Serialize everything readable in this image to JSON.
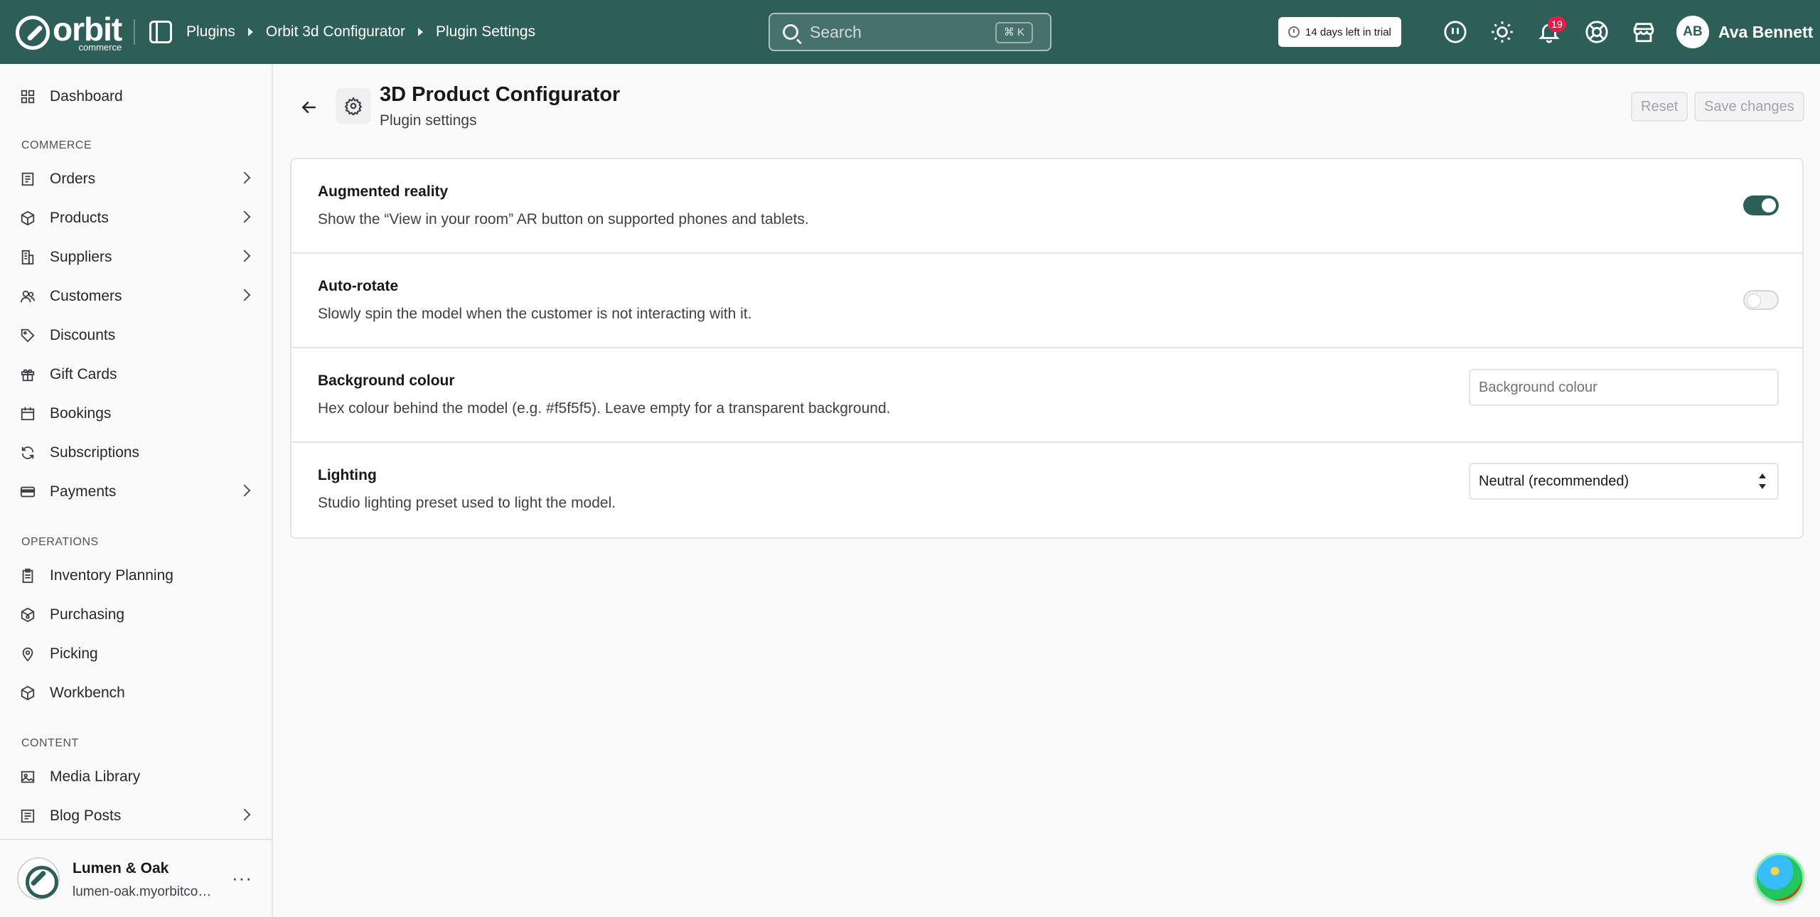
{
  "topbar": {
    "logo_text": "orbit",
    "logo_sub": "commerce",
    "breadcrumbs": [
      "Plugins",
      "Orbit 3d Configurator",
      "Plugin Settings"
    ],
    "search_placeholder": "Search",
    "search_shortcut": "⌘ K",
    "trial_text": "14 days left in trial",
    "notification_count": "19",
    "user_initials": "AB",
    "user_name": "Ava Bennett",
    "brand_color": "#2e5e58"
  },
  "sidebar": {
    "dashboard": "Dashboard",
    "sections": {
      "commerce": "COMMERCE",
      "operations": "OPERATIONS",
      "content": "CONTENT"
    },
    "commerce_items": [
      {
        "label": "Orders",
        "icon": "orders-icon",
        "expandable": true
      },
      {
        "label": "Products",
        "icon": "box-icon",
        "expandable": true
      },
      {
        "label": "Suppliers",
        "icon": "building-icon",
        "expandable": true
      },
      {
        "label": "Customers",
        "icon": "users-icon",
        "expandable": true
      },
      {
        "label": "Discounts",
        "icon": "tag-icon",
        "expandable": false
      },
      {
        "label": "Gift Cards",
        "icon": "gift-icon",
        "expandable": false
      },
      {
        "label": "Bookings",
        "icon": "calendar-icon",
        "expandable": false
      },
      {
        "label": "Subscriptions",
        "icon": "refresh-icon",
        "expandable": false
      },
      {
        "label": "Payments",
        "icon": "card-icon",
        "expandable": true
      }
    ],
    "operations_items": [
      {
        "label": "Inventory Planning",
        "icon": "clipboard-icon"
      },
      {
        "label": "Purchasing",
        "icon": "purchase-icon"
      },
      {
        "label": "Picking",
        "icon": "pin-icon"
      },
      {
        "label": "Workbench",
        "icon": "cube-icon"
      }
    ],
    "content_items": [
      {
        "label": "Media Library",
        "icon": "image-icon",
        "expandable": false
      },
      {
        "label": "Blog Posts",
        "icon": "blog-icon",
        "expandable": true
      }
    ],
    "store": {
      "name": "Lumen & Oak",
      "url": "lumen-oak.myorbitcommerce.com",
      "more": "···"
    }
  },
  "main": {
    "title": "3D Product Configurator",
    "subtitle": "Plugin settings",
    "reset_label": "Reset",
    "save_label": "Save changes",
    "settings": [
      {
        "label": "Augmented reality",
        "description": "Show the “View in your room” AR button on supported phones and tablets.",
        "control": "toggle",
        "value": true
      },
      {
        "label": "Auto-rotate",
        "description": "Slowly spin the model when the customer is not interacting with it.",
        "control": "toggle",
        "value": false
      },
      {
        "label": "Background colour",
        "description": "Hex colour behind the model (e.g. #f5f5f5). Leave empty for a transparent background.",
        "control": "text",
        "value": "",
        "placeholder": "Background colour"
      },
      {
        "label": "Lighting",
        "description": "Studio lighting preset used to light the model.",
        "control": "select",
        "value": "Neutral (recommended)"
      }
    ]
  }
}
